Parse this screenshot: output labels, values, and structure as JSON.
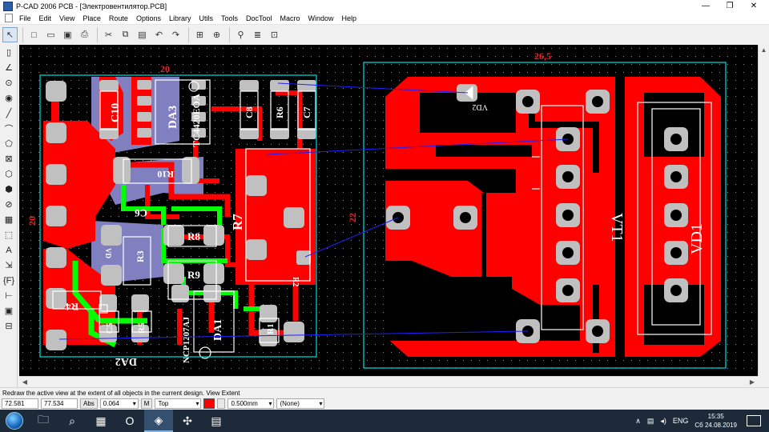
{
  "window": {
    "title": "P-CAD 2006 PCB - [Электровентилятор.PCB]",
    "controls": {
      "minimize": "—",
      "maximize": "❐",
      "close": "✕"
    }
  },
  "menu": {
    "items": [
      "File",
      "Edit",
      "View",
      "Place",
      "Route",
      "Options",
      "Library",
      "Utils",
      "Tools",
      "DocTool",
      "Macro",
      "Window",
      "Help"
    ]
  },
  "toolbar": {
    "buttons": [
      {
        "name": "select-tool-icon",
        "glyph": "↖"
      },
      {
        "name": "new-file-icon",
        "glyph": "□"
      },
      {
        "name": "open-file-icon",
        "glyph": "▭"
      },
      {
        "name": "save-icon",
        "glyph": "▣"
      },
      {
        "name": "print-icon",
        "glyph": "⎙"
      },
      {
        "name": "cut-icon",
        "glyph": "✂"
      },
      {
        "name": "copy-icon",
        "glyph": "⧉"
      },
      {
        "name": "paste-icon",
        "glyph": "▤"
      },
      {
        "name": "undo-icon",
        "glyph": "↶"
      },
      {
        "name": "redo-icon",
        "glyph": "↷"
      },
      {
        "name": "zoom-window-icon",
        "glyph": "⊞"
      },
      {
        "name": "zoom-extent-icon",
        "glyph": "⊕"
      },
      {
        "name": "drc-icon",
        "glyph": "⚲"
      },
      {
        "name": "layer-icon",
        "glyph": "≣"
      },
      {
        "name": "grid-icon",
        "glyph": "⊡"
      }
    ]
  },
  "left_tools": [
    "▯",
    "∠",
    "⊙",
    "◉",
    "╱",
    "⌒",
    "⬠",
    "⊠",
    "⬡",
    "⬢",
    "⊘",
    "▦",
    "⬚",
    "A",
    "⇲",
    "{F}",
    "⊢",
    "▣",
    "⊟"
  ],
  "board": {
    "dimension_top_left": "20",
    "dimension_left": "20",
    "dimension_top_right": "26,5",
    "dimension_middle": "22",
    "labels": {
      "da3": "DA3",
      "da3_part": "TC4420EOA",
      "c10": "C10",
      "c8": "C8",
      "r6": "R6",
      "c7": "C7",
      "r10": "R10",
      "c6": "C6",
      "r7": "R7",
      "r8": "R8",
      "r3": "R3",
      "vd": "VD",
      "r9": "R9",
      "r2": "R2",
      "r4": "R4",
      "c5": "C5",
      "r5": "R5",
      "da1": "DA1",
      "da1_part": "NCP1207AJ",
      "r1": "R1",
      "da2": "DA2",
      "vd2": "VD2",
      "vt1": "VT1",
      "vd1": "VD1"
    },
    "colors": {
      "top_copper": "#ff0000",
      "bottom_copper": "#00ff00",
      "silkscreen": "#ffffff",
      "pad": "#c0c0c0",
      "board_outline": "#00c0c0",
      "ratsnest": "#2020ff",
      "dimension": "#ff2020",
      "background": "#000000",
      "mask": "#8080c0"
    }
  },
  "statusline": "Redraw the active view at the extent of all objects in the current design. View Extent",
  "statusbar": {
    "x": "72.581",
    "y": "77.534",
    "abs_label": "Abs",
    "width": "0.064",
    "m_label": "M",
    "layer": "Top",
    "grid": "0.500mm",
    "filter": "(None)"
  },
  "taskbar": {
    "apps": [
      {
        "name": "explorer-app",
        "glyph": "🗀"
      },
      {
        "name": "search-app",
        "glyph": "⌕"
      },
      {
        "name": "calculator-app",
        "glyph": "▦"
      },
      {
        "name": "opera-app",
        "glyph": "O"
      },
      {
        "name": "pcad-app",
        "glyph": "◈"
      },
      {
        "name": "puzzle-app",
        "glyph": "✣"
      },
      {
        "name": "store-app",
        "glyph": "▤"
      }
    ],
    "language": "ENG",
    "time": "15:35",
    "date": "Сб 24.08.2019"
  }
}
